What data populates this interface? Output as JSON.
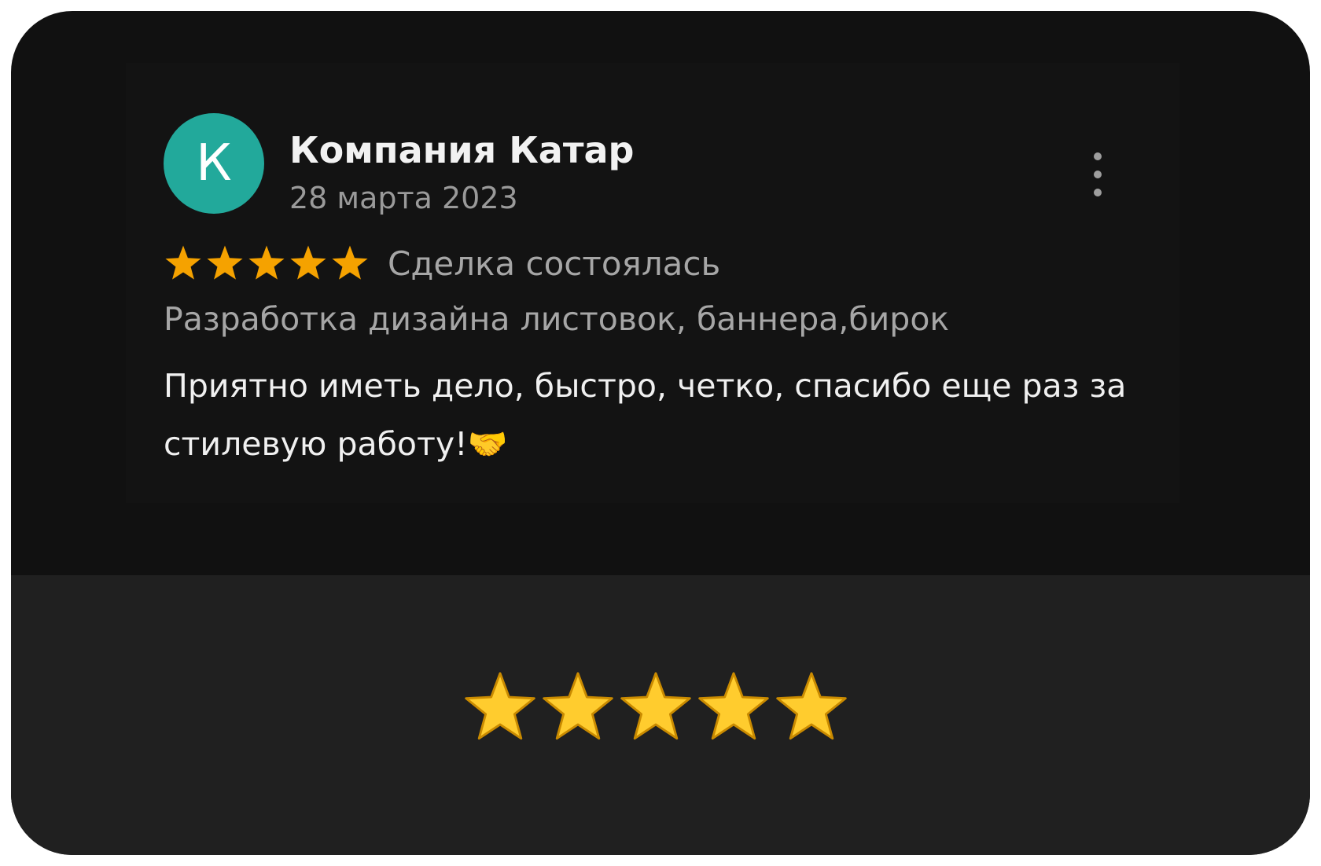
{
  "review": {
    "avatar_letter": "К",
    "avatar_color": "#22a99b",
    "author": "Компания Катар",
    "date": "28 марта 2023",
    "rating": 5,
    "rating_max": 5,
    "deal_status": "Сделка состоялась",
    "service": "Разработка дизайна листовок, баннера,бирок",
    "comment": "Приятно иметь дело, быстро, четко, спасибо еще раз за стилевую работу!🤝"
  },
  "summary": {
    "rating": 5,
    "rating_max": 5
  },
  "icons": {
    "menu": "more-vertical-icon",
    "star": "star-icon"
  },
  "colors": {
    "card_top": "#111111",
    "card_bottom": "#202020",
    "small_star": "#f5a200",
    "big_star": "#ffcc2e"
  }
}
